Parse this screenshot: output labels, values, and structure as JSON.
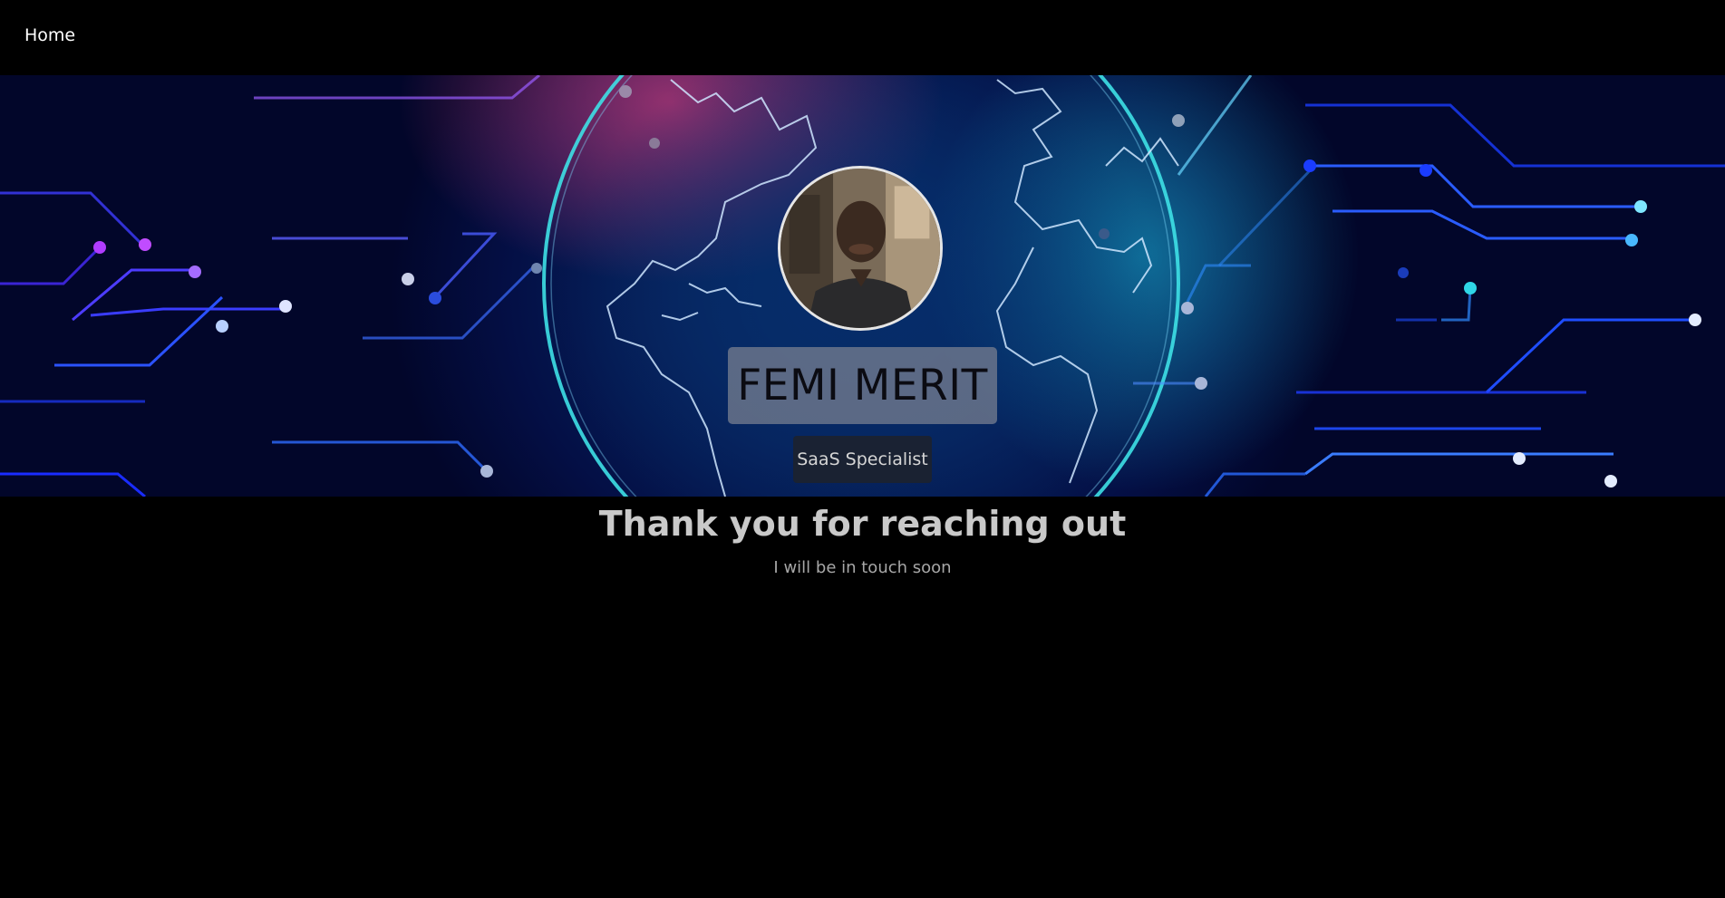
{
  "nav": {
    "home_label": "Home"
  },
  "hero": {
    "name": "FEMI MERIT",
    "role": "SaaS Specialist",
    "avatar_icon": "profile-photo"
  },
  "message": {
    "title": "Thank you for reaching out",
    "subtitle": "I will be in touch soon"
  },
  "colors": {
    "background": "#000000",
    "hero_blue": "#06245e",
    "globe_cyan": "#3ee0e6",
    "circuit_blue": "#1f4dff",
    "circuit_purple": "#b03cff"
  }
}
